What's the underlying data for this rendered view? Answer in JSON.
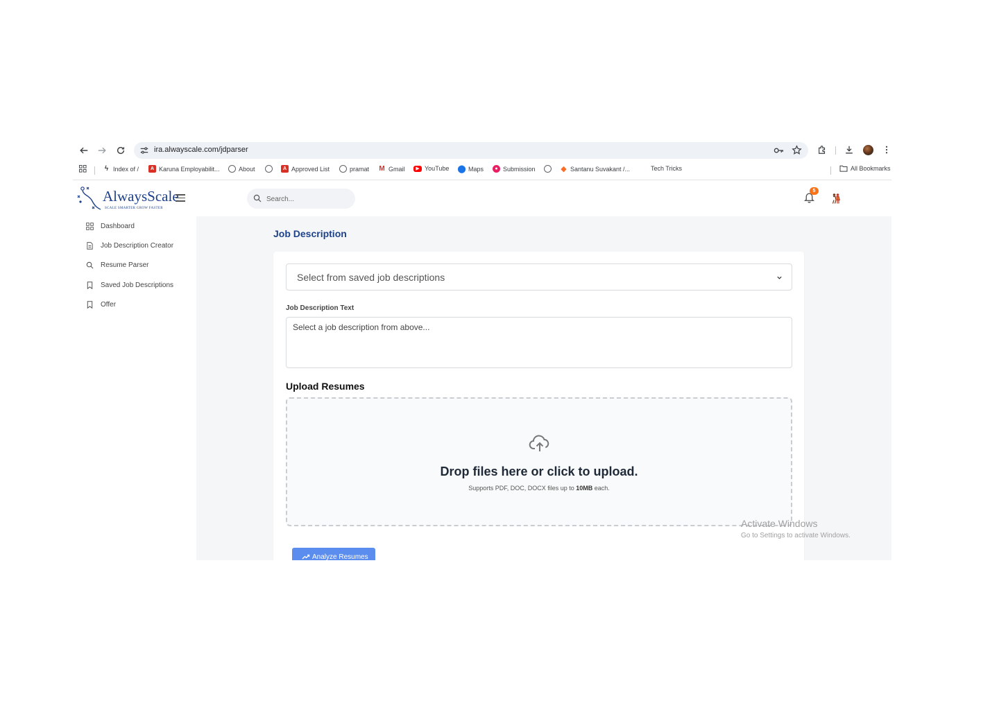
{
  "browser": {
    "url": "ira.alwayscale.com/jdparser",
    "bookmarks": [
      {
        "label": "Index of /",
        "icon": "flash-icon"
      },
      {
        "label": "Karuna Employabilit...",
        "icon": "angular-icon"
      },
      {
        "label": "About",
        "icon": "globe-icon"
      },
      {
        "label": "",
        "icon": "globe-icon"
      },
      {
        "label": "Approved List",
        "icon": "angular-icon"
      },
      {
        "label": "pramat",
        "icon": "globe-icon"
      },
      {
        "label": "Gmail",
        "icon": "gmail-icon"
      },
      {
        "label": "YouTube",
        "icon": "youtube-icon"
      },
      {
        "label": "Maps",
        "icon": "maps-icon"
      },
      {
        "label": "Submission",
        "icon": "submission-icon"
      },
      {
        "label": "",
        "icon": "globe-icon"
      },
      {
        "label": "Santanu Suvakant /...",
        "icon": "gitlab-icon"
      },
      {
        "label": "Tech Tricks",
        "icon": ""
      }
    ],
    "all_bookmarks": "All Bookmarks"
  },
  "sidebar": {
    "logo_name": "AlwaysScale",
    "logo_tagline": "SCALE SMARTER GROW FASTER",
    "items": [
      {
        "label": "Dashboard",
        "icon": "grid-icon"
      },
      {
        "label": "Job Description Creator",
        "icon": "document-icon"
      },
      {
        "label": "Resume Parser",
        "icon": "search-icon"
      },
      {
        "label": "Saved Job Descriptions",
        "icon": "bookmark-icon"
      },
      {
        "label": "Offer",
        "icon": "bookmark-icon"
      }
    ]
  },
  "topbar": {
    "search_placeholder": "Search...",
    "notification_count": "5"
  },
  "main": {
    "title": "Job Description",
    "select_value": "Select from saved job descriptions",
    "jd_label": "Job Description Text",
    "jd_placeholder": "Select a job description from above...",
    "upload_title": "Upload Resumes",
    "drop_title": "Drop files here or click to upload.",
    "drop_sub_prefix": "Supports PDF, DOC, DOCX files up to ",
    "drop_sub_bold": "10MB",
    "drop_sub_suffix": " each.",
    "analyze_label": "Analyze Resumes"
  },
  "watermark": {
    "line1": "Activate Windows",
    "line2": "Go to Settings to activate Windows."
  },
  "colors": {
    "brand": "#1d4289",
    "accent_button": "#5b8def",
    "badge": "#f97316"
  }
}
